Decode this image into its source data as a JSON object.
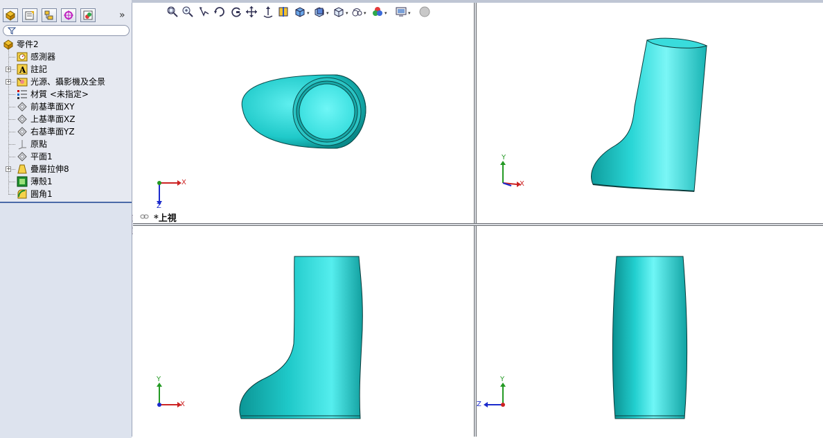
{
  "feature_tree": {
    "root": "零件2",
    "items": [
      {
        "label": "感測器",
        "expandable": false
      },
      {
        "label": "註記",
        "expandable": true
      },
      {
        "label": "光源、攝影機及全景",
        "expandable": true
      },
      {
        "label": "材質 <未指定>",
        "expandable": false
      },
      {
        "label": "前基準面XY",
        "expandable": false
      },
      {
        "label": "上基準面XZ",
        "expandable": false
      },
      {
        "label": "右基準面YZ",
        "expandable": false
      },
      {
        "label": "原點",
        "expandable": false
      },
      {
        "label": "平面1",
        "expandable": false
      },
      {
        "label": "疊層拉伸8",
        "expandable": true
      },
      {
        "label": "薄殼1",
        "expandable": false
      },
      {
        "label": "圓角1",
        "expandable": false
      }
    ],
    "more_tabs": "»"
  },
  "viewports": {
    "top_left": {
      "view_name": "*上視"
    }
  },
  "axes": {
    "x": "X",
    "y": "Y",
    "z": "Z"
  },
  "colors": {
    "model": "#1fc9c9",
    "model_dark": "#0a8a8a",
    "model_light": "#6ff2f2",
    "axis_x": "#cc2222",
    "axis_y": "#229922",
    "axis_z": "#1a2acc"
  },
  "icons": [
    "zoom-to-fit-icon",
    "zoom-area-icon",
    "previous-view-icon",
    "rotate-icon",
    "redraw-icon",
    "pan-icon",
    "roll-icon",
    "section-view-icon",
    "view-orientation-icon",
    "display-style-icon",
    "hide-show-icon",
    "edit-appearance-icon",
    "apply-scene-icon",
    "view-settings-icon",
    "realview-icon"
  ]
}
